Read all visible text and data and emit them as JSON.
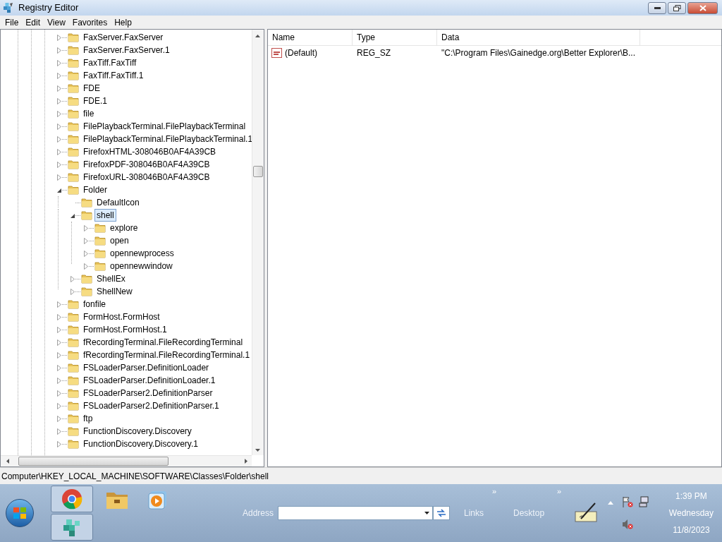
{
  "window": {
    "title": "Registry Editor"
  },
  "menu": [
    "File",
    "Edit",
    "View",
    "Favorites",
    "Help"
  ],
  "tree": [
    {
      "label": "FaxServer.FaxServer",
      "has_children": true,
      "expanded": false,
      "selected": false
    },
    {
      "label": "FaxServer.FaxServer.1",
      "has_children": true,
      "expanded": false,
      "selected": false
    },
    {
      "label": "FaxTiff.FaxTiff",
      "has_children": true,
      "expanded": false,
      "selected": false
    },
    {
      "label": "FaxTiff.FaxTiff.1",
      "has_children": true,
      "expanded": false,
      "selected": false
    },
    {
      "label": "FDE",
      "has_children": true,
      "expanded": false,
      "selected": false
    },
    {
      "label": "FDE.1",
      "has_children": true,
      "expanded": false,
      "selected": false
    },
    {
      "label": "file",
      "has_children": true,
      "expanded": false,
      "selected": false
    },
    {
      "label": "FilePlaybackTerminal.FilePlaybackTerminal",
      "has_children": true,
      "expanded": false,
      "selected": false
    },
    {
      "label": "FilePlaybackTerminal.FilePlaybackTerminal.1",
      "has_children": true,
      "expanded": false,
      "selected": false
    },
    {
      "label": "FirefoxHTML-308046B0AF4A39CB",
      "has_children": true,
      "expanded": false,
      "selected": false
    },
    {
      "label": "FirefoxPDF-308046B0AF4A39CB",
      "has_children": true,
      "expanded": false,
      "selected": false
    },
    {
      "label": "FirefoxURL-308046B0AF4A39CB",
      "has_children": true,
      "expanded": false,
      "selected": false
    },
    {
      "label": "Folder",
      "has_children": true,
      "expanded": true,
      "selected": false,
      "children": [
        {
          "label": "DefaultIcon",
          "has_children": false,
          "expanded": false,
          "selected": false
        },
        {
          "label": "shell",
          "has_children": true,
          "expanded": true,
          "selected": true,
          "children": [
            {
              "label": "explore",
              "has_children": true,
              "expanded": false,
              "selected": false
            },
            {
              "label": "open",
              "has_children": true,
              "expanded": false,
              "selected": false
            },
            {
              "label": "opennewprocess",
              "has_children": true,
              "expanded": false,
              "selected": false
            },
            {
              "label": "opennewwindow",
              "has_children": true,
              "expanded": false,
              "selected": false
            }
          ]
        },
        {
          "label": "ShellEx",
          "has_children": true,
          "expanded": false,
          "selected": false
        },
        {
          "label": "ShellNew",
          "has_children": true,
          "expanded": false,
          "selected": false
        }
      ]
    },
    {
      "label": "fonfile",
      "has_children": true,
      "expanded": false,
      "selected": false
    },
    {
      "label": "FormHost.FormHost",
      "has_children": true,
      "expanded": false,
      "selected": false
    },
    {
      "label": "FormHost.FormHost.1",
      "has_children": true,
      "expanded": false,
      "selected": false
    },
    {
      "label": "fRecordingTerminal.FileRecordingTerminal",
      "has_children": true,
      "expanded": false,
      "selected": false
    },
    {
      "label": "fRecordingTerminal.FileRecordingTerminal.1",
      "has_children": true,
      "expanded": false,
      "selected": false
    },
    {
      "label": "FSLoaderParser.DefinitionLoader",
      "has_children": true,
      "expanded": false,
      "selected": false
    },
    {
      "label": "FSLoaderParser.DefinitionLoader.1",
      "has_children": true,
      "expanded": false,
      "selected": false
    },
    {
      "label": "FSLoaderParser2.DefinitionParser",
      "has_children": true,
      "expanded": false,
      "selected": false
    },
    {
      "label": "FSLoaderParser2.DefinitionParser.1",
      "has_children": true,
      "expanded": false,
      "selected": false
    },
    {
      "label": "ftp",
      "has_children": true,
      "expanded": false,
      "selected": false
    },
    {
      "label": "FunctionDiscovery.Discovery",
      "has_children": true,
      "expanded": false,
      "selected": false
    },
    {
      "label": "FunctionDiscovery.Discovery.1",
      "has_children": true,
      "expanded": false,
      "selected": false
    }
  ],
  "values": {
    "columns": [
      "Name",
      "Type",
      "Data"
    ],
    "rows": [
      {
        "name": "(Default)",
        "type": "REG_SZ",
        "data": "\"C:\\Program Files\\Gainedge.org\\Better Explorer\\B..."
      }
    ]
  },
  "status_bar": "Computer\\HKEY_LOCAL_MACHINE\\SOFTWARE\\Classes\\Folder\\shell",
  "taskbar": {
    "address_label": "Address",
    "links_label": "Links",
    "links_chevron": "»",
    "desktop_label": "Desktop",
    "desktop_chevron": "»",
    "time": "1:39 PM",
    "day": "Wednesday",
    "date": "11/8/2023"
  }
}
